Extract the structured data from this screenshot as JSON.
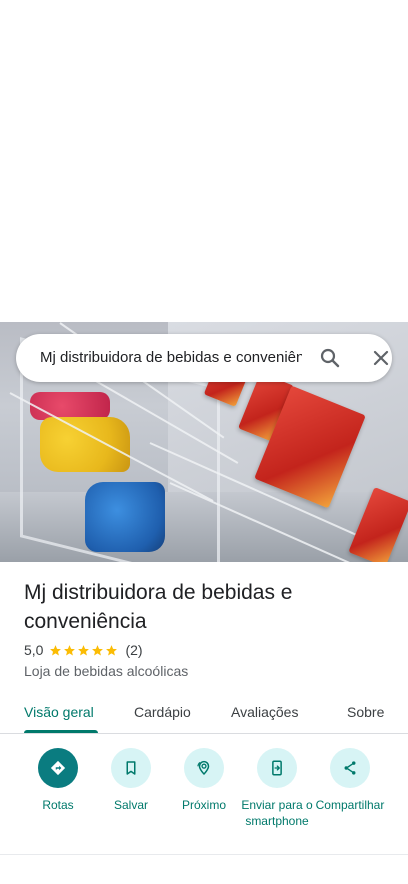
{
  "search": {
    "query": "Mj distribuidora de bebidas e conveniência",
    "search_icon": "search-icon",
    "close_icon": "close-icon"
  },
  "place": {
    "title": "Mj distribuidora de bebidas e conveniência",
    "rating": "5,0",
    "stars": 5,
    "review_count": "(2)",
    "category": "Loja de bebidas alcoólicas"
  },
  "tabs": [
    {
      "label": "Visão geral",
      "active": true
    },
    {
      "label": "Cardápio",
      "active": false
    },
    {
      "label": "Avaliações",
      "active": false
    },
    {
      "label": "Sobre",
      "active": false
    }
  ],
  "actions": [
    {
      "label": "Rotas",
      "icon": "directions-icon"
    },
    {
      "label": "Salvar",
      "icon": "bookmark-icon"
    },
    {
      "label": "Próximo",
      "icon": "nearby-icon"
    },
    {
      "label": "Enviar para o smartphone",
      "icon": "send-to-phone-icon"
    },
    {
      "label": "Compartilhar",
      "icon": "share-icon"
    }
  ],
  "colors": {
    "accent": "#00796b",
    "primary_action_bg": "#0a7c80",
    "action_bg": "#d7f4f5",
    "star": "#fbbc04"
  }
}
